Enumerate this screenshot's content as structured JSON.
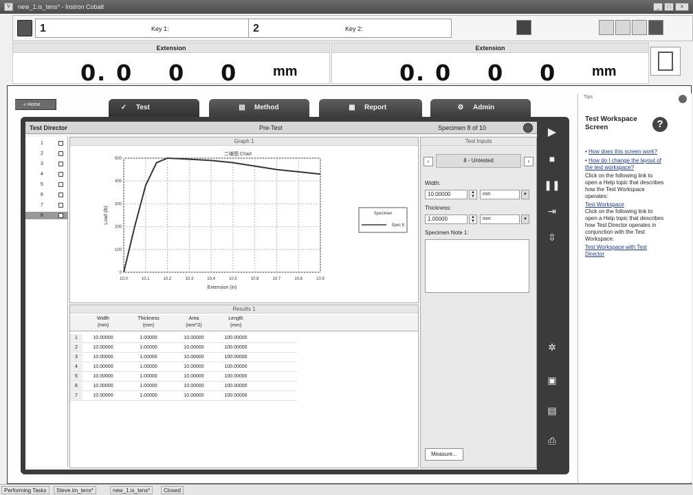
{
  "window": {
    "title": "new_1.is_tens* - Instron Cobalt",
    "app_icon": "instron-logo-icon"
  },
  "keybar": {
    "key1_num": "1",
    "key1_label": "Key 1:",
    "key2_num": "2",
    "key2_label": "Key 2:"
  },
  "readouts": [
    {
      "header": "Extension",
      "d1": "0",
      "sep": ".",
      "d2": "0",
      "d3": "0",
      "d4": "0",
      "unit": "mm"
    },
    {
      "header": "Extension",
      "d1": "0",
      "sep": ".",
      "d2": "0",
      "d3": "0",
      "d4": "0",
      "unit": "mm"
    }
  ],
  "nav": {
    "home": "« Home",
    "tabs": [
      {
        "label": "Test",
        "icon": "test-icon",
        "active": true
      },
      {
        "label": "Method",
        "icon": "method-icon",
        "active": false
      },
      {
        "label": "Report",
        "icon": "report-icon",
        "active": false
      },
      {
        "label": "Admin",
        "icon": "admin-icon",
        "active": false
      }
    ]
  },
  "test_director": {
    "title": "Test Director",
    "state": "Pre-Test",
    "specimen_counter": "Specimen 8 of 10",
    "specimens": [
      "1",
      "2",
      "3",
      "4",
      "5",
      "6",
      "7",
      "8"
    ],
    "selected_specimen": "8"
  },
  "graph": {
    "panel_title": "Graph 1"
  },
  "chart_data": {
    "type": "line",
    "title": "二维图 Chart",
    "xlabel": "Extension (in)",
    "ylabel": "Load (lb)",
    "xlim": [
      10.0,
      10.9
    ],
    "ylim": [
      0,
      500
    ],
    "xticks": [
      "10.0",
      "10.1",
      "10.2",
      "10.3",
      "10.4",
      "10.5",
      "10.6",
      "10.7",
      "10.8",
      "10.9"
    ],
    "yticks": [
      "0",
      "100",
      "200",
      "300",
      "400",
      "500"
    ],
    "grid": true,
    "legend_title": "Specimen",
    "legend_position": "right",
    "series": [
      {
        "name": "Spec 8",
        "x": [
          10.0,
          10.05,
          10.1,
          10.15,
          10.2,
          10.3,
          10.4,
          10.5,
          10.6,
          10.7,
          10.8,
          10.9
        ],
        "y": [
          0,
          200,
          380,
          480,
          500,
          495,
          490,
          480,
          465,
          450,
          440,
          430
        ]
      }
    ]
  },
  "results": {
    "panel_title": "Results 1",
    "headers": [
      {
        "name": "Width",
        "unit": "(mm)"
      },
      {
        "name": "Thickness",
        "unit": "(mm)"
      },
      {
        "name": "Area",
        "unit": "(mm^2)"
      },
      {
        "name": "Length",
        "unit": "(mm)"
      }
    ],
    "rows": [
      [
        "1",
        "10.00000",
        "1.00000",
        "10.00000",
        "100.00000"
      ],
      [
        "2",
        "10.00000",
        "1.00000",
        "10.00000",
        "100.00000"
      ],
      [
        "3",
        "10.00000",
        "1.00000",
        "10.00000",
        "100.00000"
      ],
      [
        "4",
        "10.00000",
        "1.00000",
        "10.00000",
        "100.00000"
      ],
      [
        "5",
        "10.00000",
        "1.00000",
        "10.00000",
        "100.00000"
      ],
      [
        "6",
        "10.00000",
        "1.00000",
        "10.00000",
        "100.00000"
      ],
      [
        "7",
        "10.00000",
        "1.00000",
        "10.00000",
        "100.00000"
      ]
    ]
  },
  "inputs": {
    "panel_title": "Test Inputs",
    "specimen_selector": "8 - Untested",
    "width_label": "Width:",
    "width_value": "10.00000",
    "width_unit": "mm",
    "thickness_label": "Thickness:",
    "thickness_value": "1.00000",
    "thickness_unit": "mm",
    "note_label": "Specimen Note 1:",
    "measure_button": "Measure..."
  },
  "tips": {
    "header": "Tips",
    "title": "Test Workspace Screen",
    "link1": "How does this screen work?",
    "link2": "How do I change the layout of the test workspace?",
    "text1": "Click on the following link to open a Help topic that describes how the Test Workspace operates:",
    "link3": "Test Workspace",
    "text2": "Click on the following link to open a Help topic that describes how Test Director operates in conjunction with the Test Workspace:",
    "link4": "Test Workspace with Test Director"
  },
  "statusbar": {
    "item1": "Performing Tasks",
    "item2": "Steve.im_tens*",
    "item3": "new_1.is_tens*",
    "item4": "Closed"
  }
}
